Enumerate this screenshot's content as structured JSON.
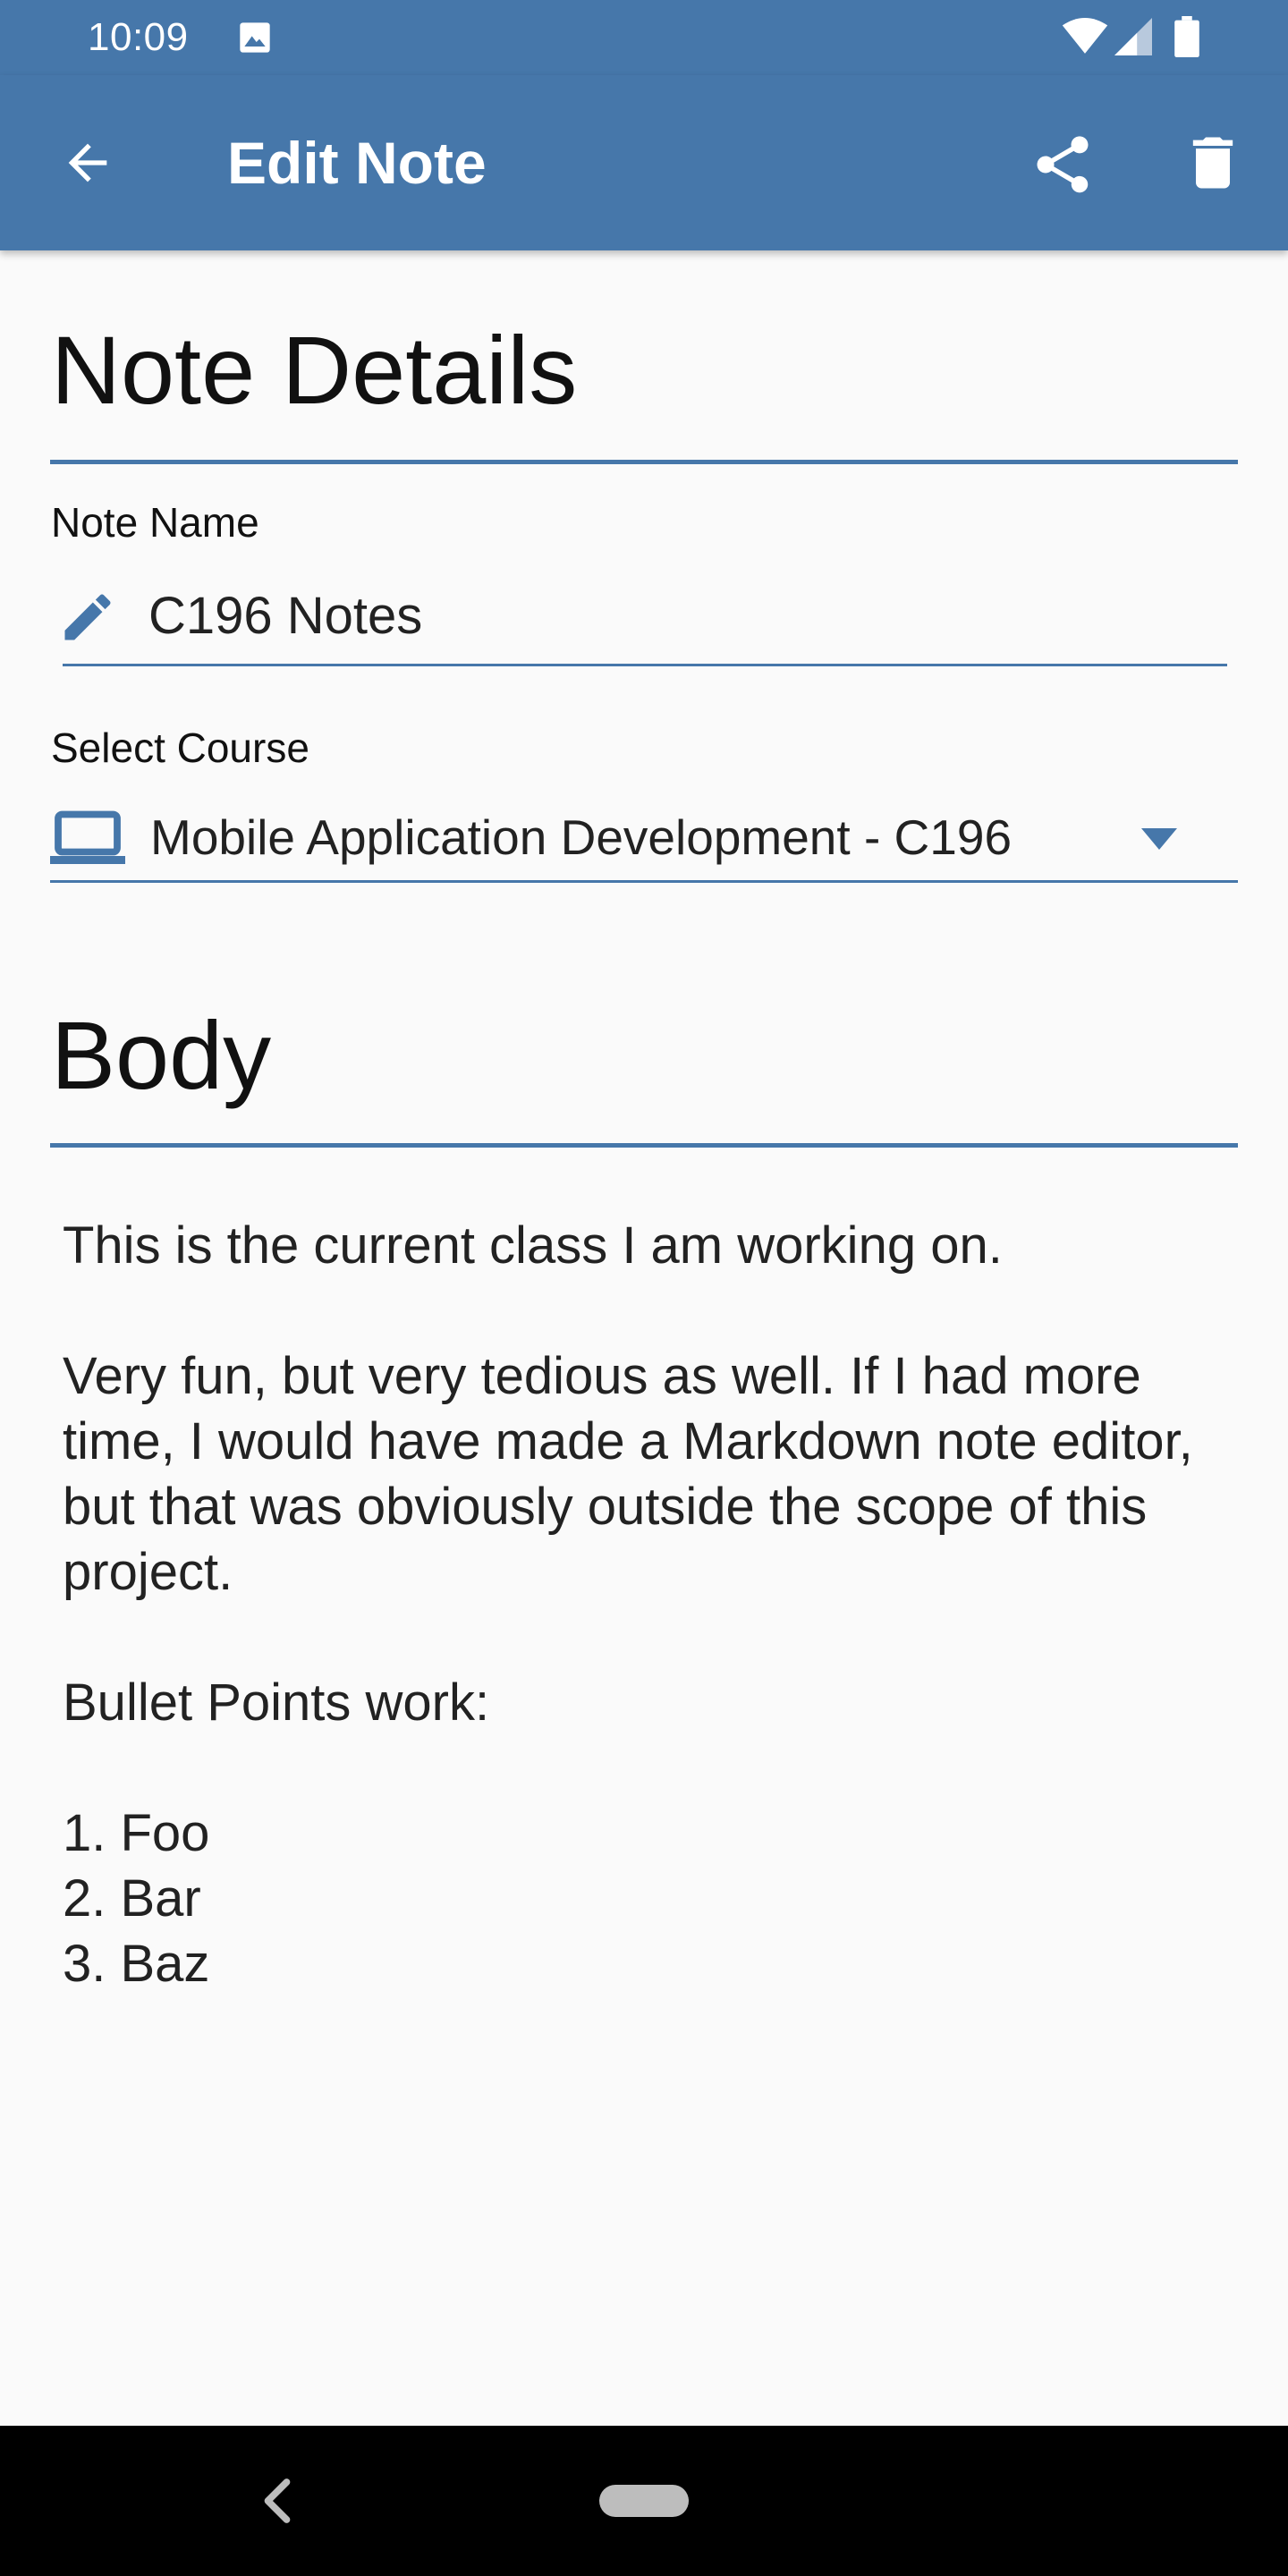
{
  "status_bar": {
    "time": "10:09"
  },
  "app_bar": {
    "title": "Edit Note",
    "background_color": "#4677aa",
    "icons": [
      "back-arrow-icon",
      "share-icon",
      "delete-icon"
    ]
  },
  "note_details": {
    "heading": "Note Details",
    "note_name_label": "Note Name",
    "note_name_value": "C196 Notes",
    "select_course_label": "Select Course",
    "selected_course": "Mobile Application Development - C196"
  },
  "body_section": {
    "heading": "Body",
    "text": "This is the current class I am working on.\n\nVery fun, but very tedious as well. If I had more time, I would have made a Markdown note editor, but that was obviously outside the scope of this project.\n\nBullet Points work:\n\n1. Foo\n2. Bar\n3. Baz"
  },
  "theme": {
    "accent": "#4677aa",
    "background": "#fafafa"
  }
}
